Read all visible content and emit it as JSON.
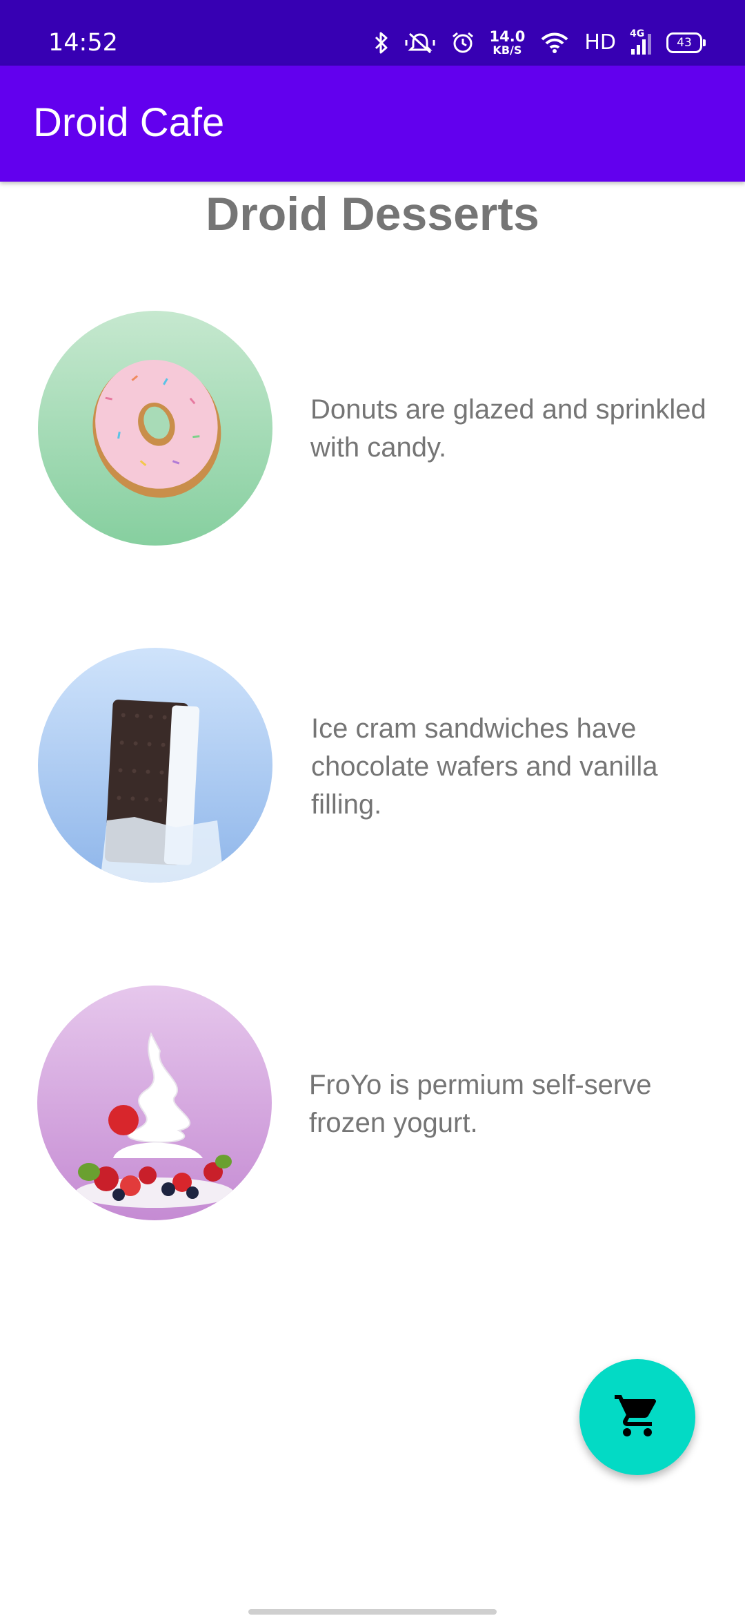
{
  "status_bar": {
    "time": "14:52",
    "network_speed_value": "14.0",
    "network_speed_unit": "KB/S",
    "hd_label": "HD",
    "network_type": "4G",
    "battery_level": "43",
    "icons": [
      "bluetooth-icon",
      "vibrate-icon",
      "alarm-icon",
      "wifi-icon",
      "signal-icon",
      "battery-icon"
    ]
  },
  "app_bar": {
    "title": "Droid Cafe"
  },
  "main": {
    "heading": "Droid Desserts",
    "items": [
      {
        "name": "donut",
        "description": "Donuts are glazed and sprinkled with candy."
      },
      {
        "name": "ice-cream-sandwich",
        "description": "Ice cram sandwiches have chocolate wafers and vanilla filling."
      },
      {
        "name": "froyo",
        "description": "FroYo is permium self-serve frozen yogurt."
      }
    ]
  },
  "fab": {
    "icon": "shopping-cart-icon"
  },
  "colors": {
    "status_bar": "#3700B3",
    "app_bar": "#6200EE",
    "fab": "#03DAC5",
    "text_secondary": "#757575"
  }
}
